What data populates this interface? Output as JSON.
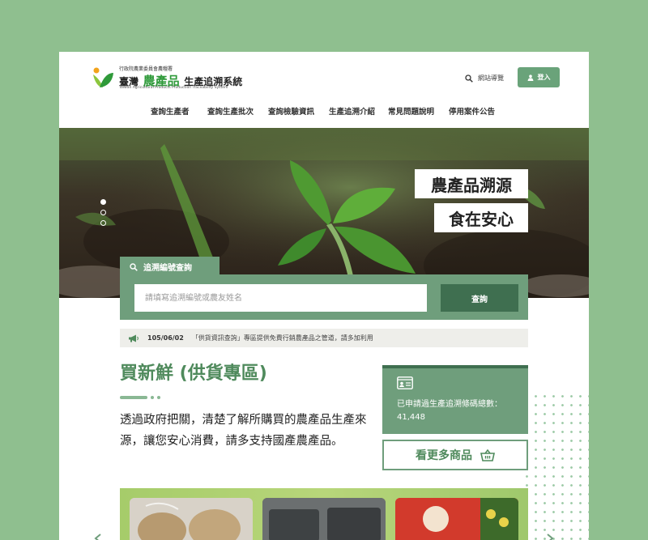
{
  "header": {
    "logo_top": "行政院農業委員會農糧署",
    "logo_a": "臺灣",
    "logo_b": "農產品",
    "logo_c": "生產追溯系統",
    "logo_en": "Taiwan Agricultural Products Production Traceability System",
    "search_label": "網站導覽",
    "login_label": "登入"
  },
  "nav": {
    "items": [
      "查詢生產者",
      "查詢生產批次",
      "查詢檢驗資訊",
      "生產追溯介紹",
      "常見問題說明",
      "停用案件公告"
    ]
  },
  "hero": {
    "slogan_1": "農產品溯源",
    "slogan_2": "食在安心",
    "slides": 3,
    "active_slide": 1
  },
  "query": {
    "tab_label": "追溯編號查詢",
    "placeholder": "請填寫追溯編號或農友姓名",
    "button_label": "查詢"
  },
  "news": {
    "date": "105/06/02",
    "text": "「供貨資訊查詢」專區提供免費行銷農產品之管道，請多加利用"
  },
  "section": {
    "title": "買新鮮 (供貨專區)",
    "description": "透過政府把關，清楚了解所購買的農產品生產來源，讓您安心消費，請多支持國產農產品。",
    "counter_text": "已申請過生產追溯條碼總數：41,448",
    "more_label": "看更多商品"
  },
  "colors": {
    "primary": "#6f9e7c",
    "dark": "#3f6f50",
    "title": "#4f8a5c",
    "background": "#8fbf8f"
  }
}
